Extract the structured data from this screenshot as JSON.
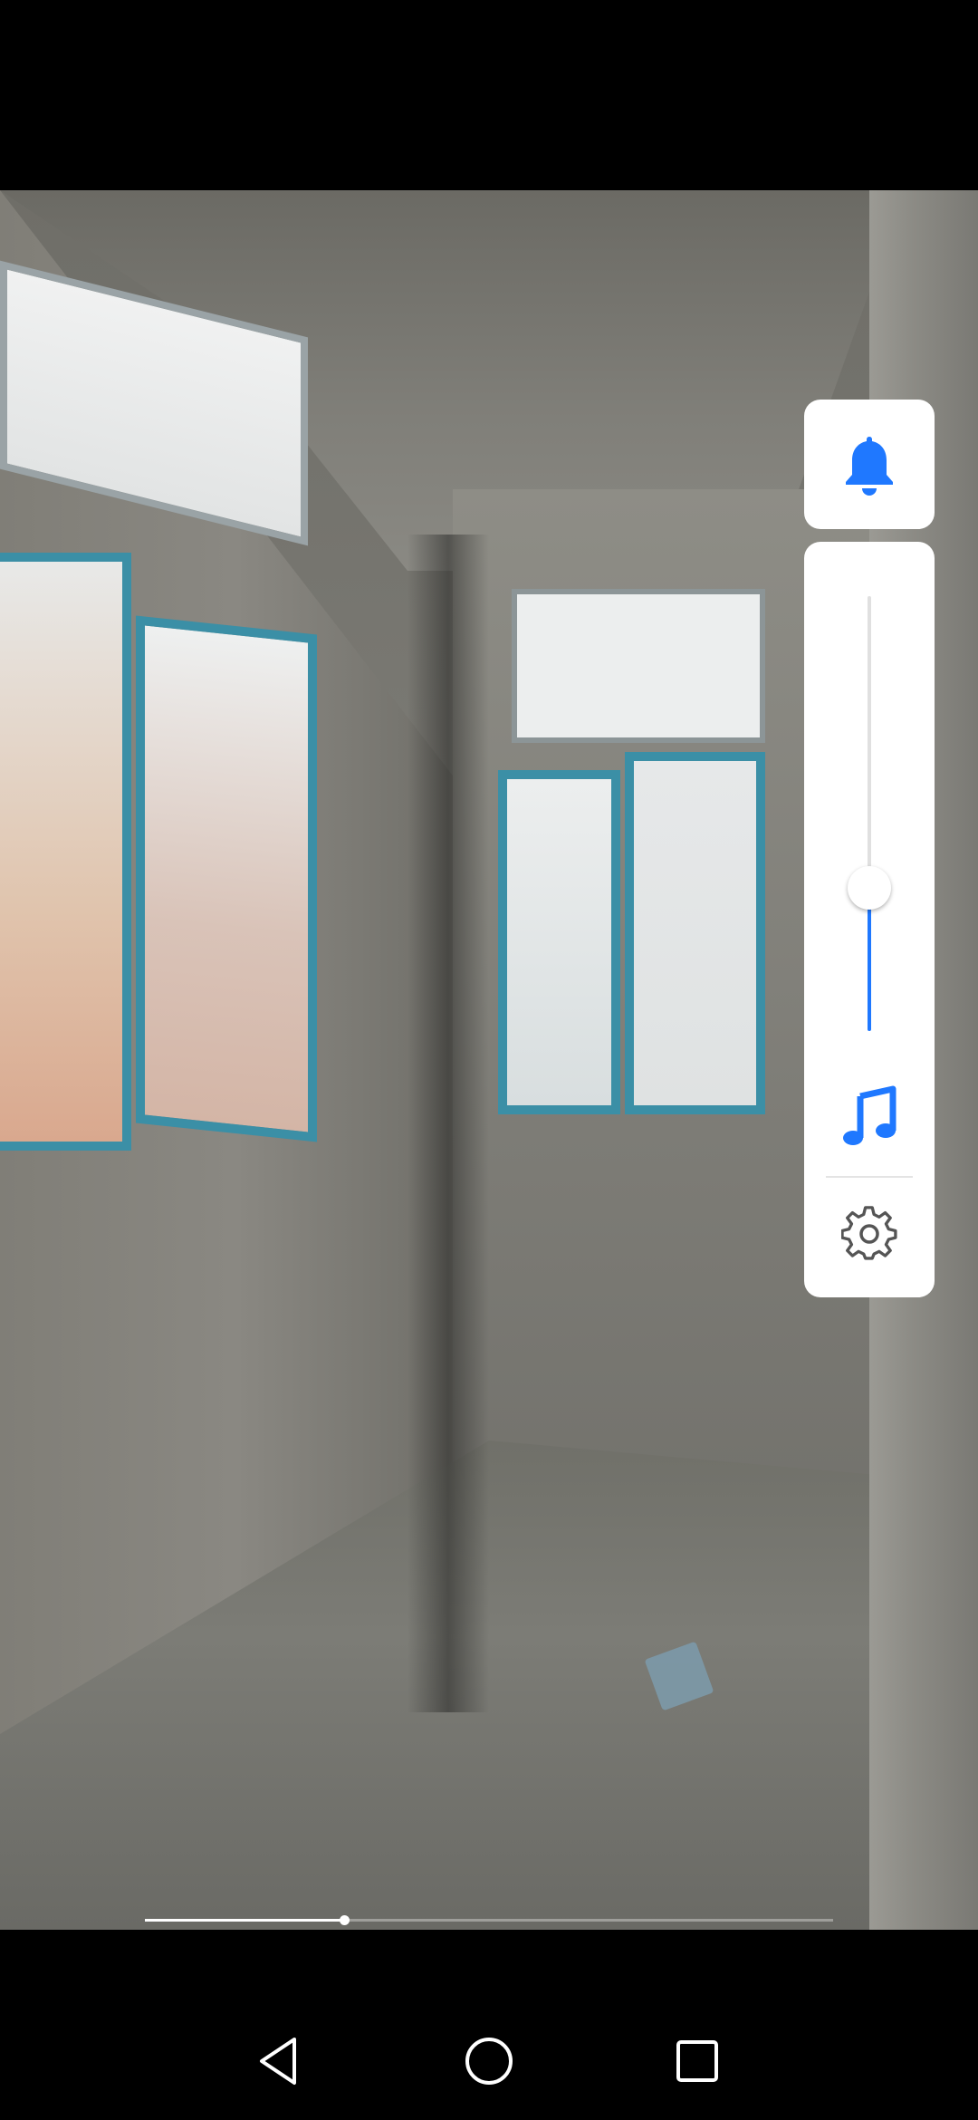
{
  "video": {
    "progress_fraction": 0.29
  },
  "volume_panel": {
    "accent_color": "#1f78ff",
    "ringer_icon": "bell-icon",
    "media_icon": "music-note-icon",
    "settings_icon": "gear-icon",
    "level_fraction": 0.33
  },
  "navigation_bar": {
    "back_icon": "back-triangle-icon",
    "home_icon": "home-circle-icon",
    "recents_icon": "recents-square-icon"
  }
}
